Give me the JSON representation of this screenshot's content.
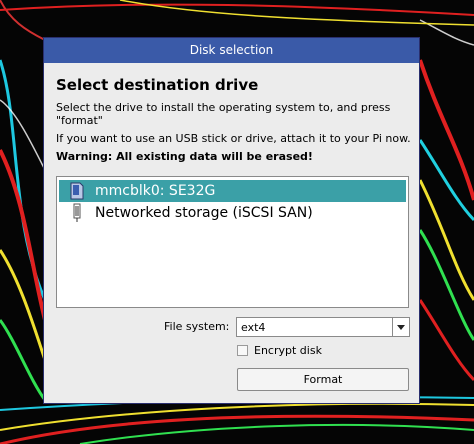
{
  "dialog": {
    "title": "Disk selection",
    "heading": "Select destination drive",
    "instruction": "Select the drive to install the operating system to, and press\n\"format\"",
    "usb_hint": "If you want to use an USB stick or drive, attach it to your Pi now.",
    "warning": "Warning: All existing data will be erased!"
  },
  "drives": [
    {
      "label": "mmcblk0: SE32G",
      "icon": "sd-card-icon",
      "selected": true
    },
    {
      "label": "Networked storage (iSCSI SAN)",
      "icon": "network-storage-icon",
      "selected": false
    }
  ],
  "filesystem": {
    "label": "File system:",
    "value": "ext4"
  },
  "encrypt": {
    "label": "Encrypt disk",
    "checked": false
  },
  "format_button": "Format",
  "colors": {
    "titlebar": "#3a5aa8",
    "selection": "#3ba0a7",
    "dialog_bg": "#ececec"
  }
}
